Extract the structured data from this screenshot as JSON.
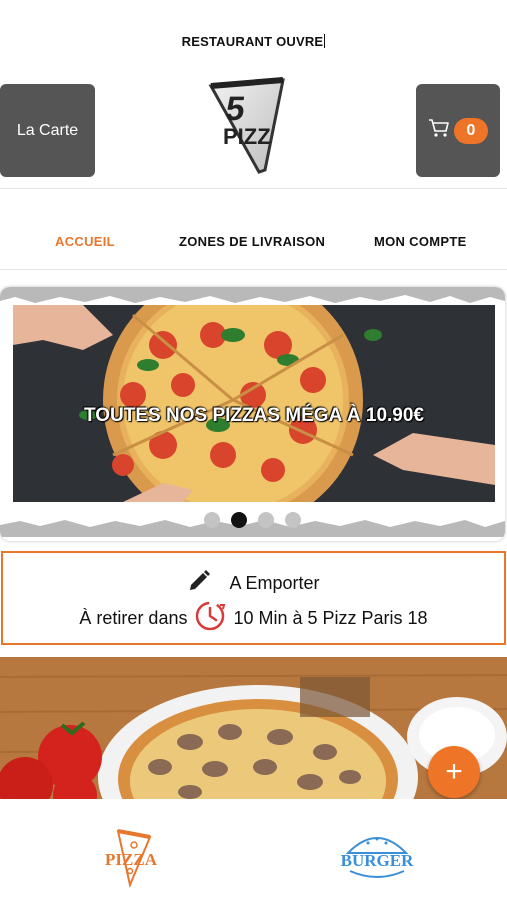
{
  "status": {
    "text": "RESTAURANT OUVRE"
  },
  "header": {
    "menu_label": "La Carte",
    "logo_text": "PIZZ",
    "logo_number": "5",
    "cart_count": "0"
  },
  "tabs": [
    {
      "label": "ACCUEIL",
      "active": true
    },
    {
      "label": "ZONES DE LIVRAISON",
      "active": false
    },
    {
      "label": "MON COMPTE",
      "active": false
    }
  ],
  "carousel": {
    "caption": "TOUTES NOS PIZZAS MÉGA À 10.90€",
    "dot_count": 4,
    "active_index": 1
  },
  "pickup": {
    "mode": "A Emporter",
    "prefix": "À retirer dans",
    "detail": "10 Min à 5 Pizz Paris 18"
  },
  "fab": {
    "label": "+"
  },
  "bottom_nav": {
    "pizza_label": "PIZZA",
    "burger_label": "BURGER"
  },
  "colors": {
    "accent": "#ee7428",
    "button_gray": "#555555",
    "burger_blue": "#3a8fd8"
  }
}
